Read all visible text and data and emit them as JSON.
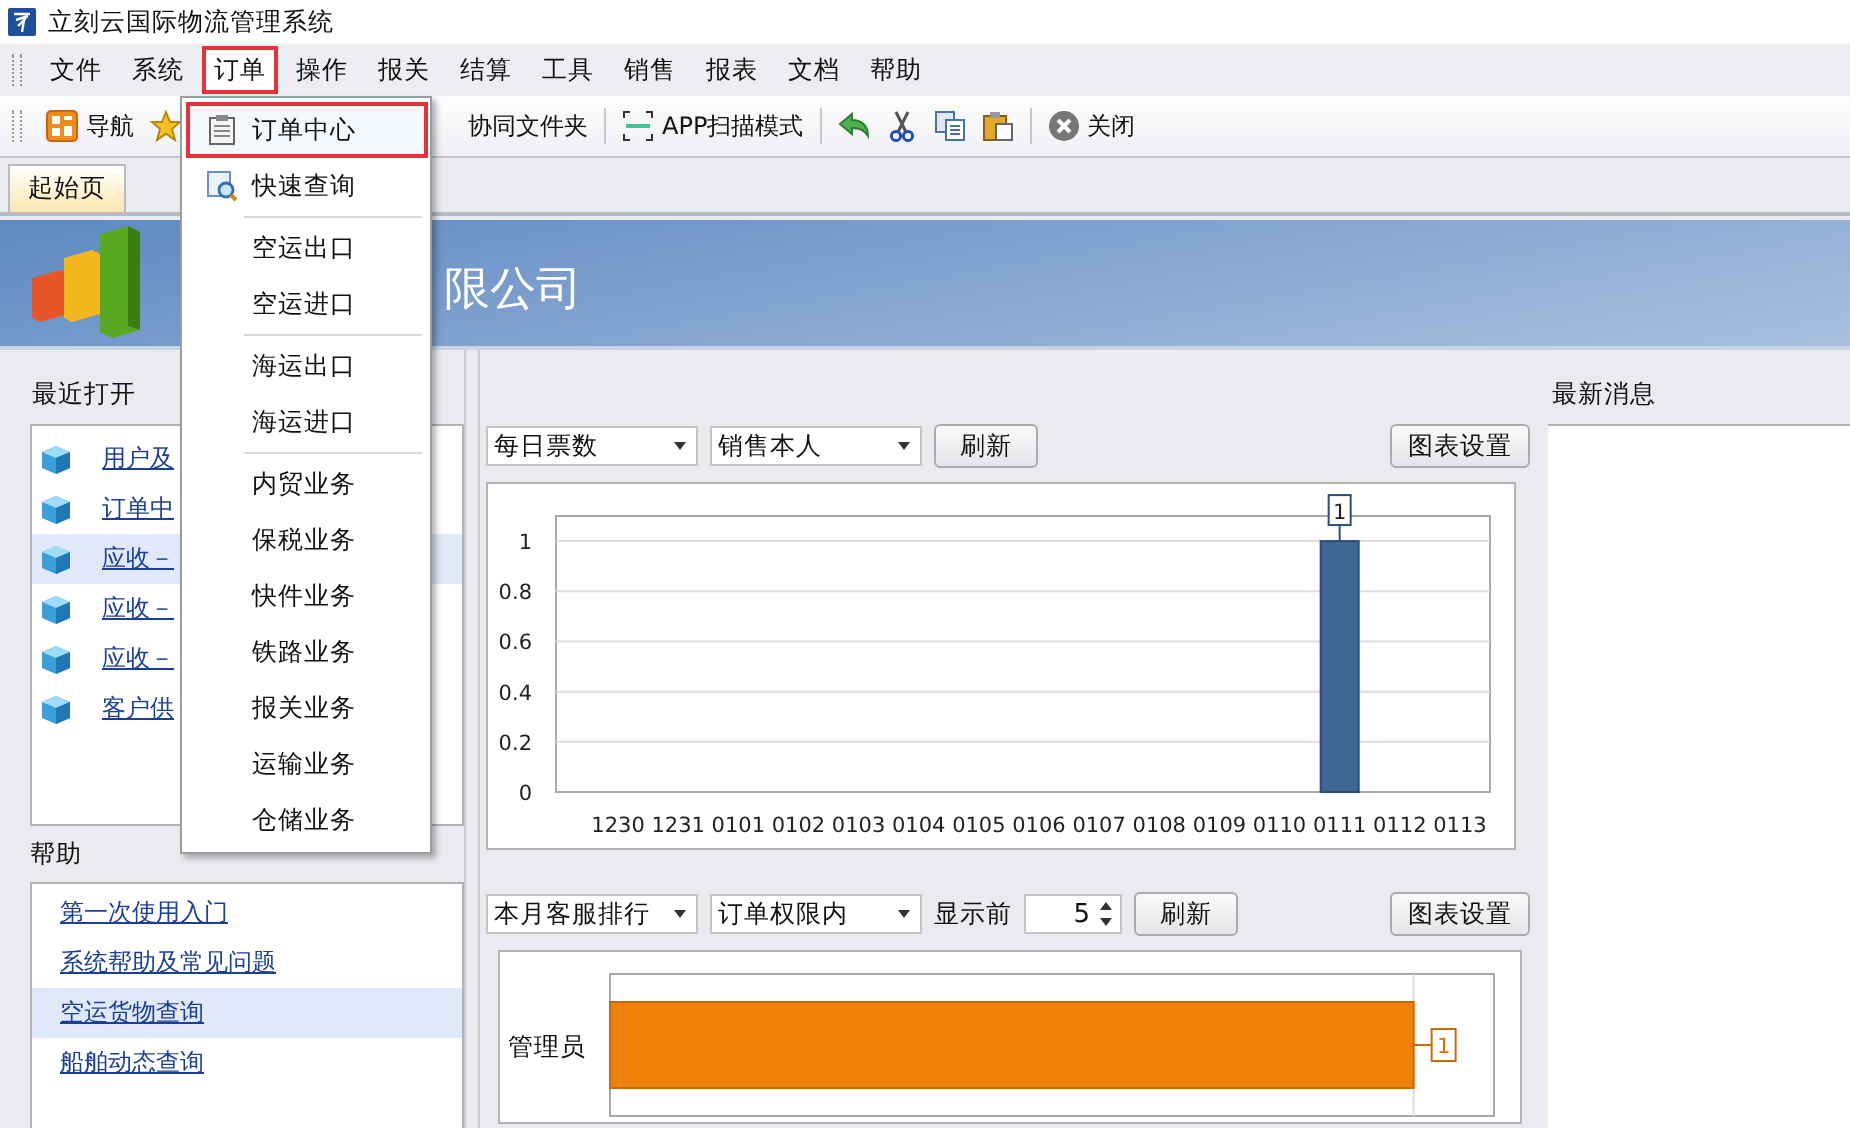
{
  "window": {
    "title": "立刻云国际物流管理系统"
  },
  "menu_bar": [
    {
      "label": "文件",
      "selected": false
    },
    {
      "label": "系统",
      "selected": false
    },
    {
      "label": "订单",
      "selected": true
    },
    {
      "label": "操作",
      "selected": false
    },
    {
      "label": "报关",
      "selected": false
    },
    {
      "label": "结算",
      "selected": false
    },
    {
      "label": "工具",
      "selected": false
    },
    {
      "label": "销售",
      "selected": false
    },
    {
      "label": "报表",
      "selected": false
    },
    {
      "label": "文档",
      "selected": false
    },
    {
      "label": "帮助",
      "selected": false
    }
  ],
  "toolbar": [
    {
      "kind": "nav",
      "label": "导航"
    },
    {
      "kind": "star"
    },
    {
      "kind": "text",
      "label": "协同文件夹"
    },
    {
      "kind": "separator"
    },
    {
      "kind": "scan",
      "label": "APP扫描模式"
    },
    {
      "kind": "separator"
    },
    {
      "kind": "undo"
    },
    {
      "kind": "cut"
    },
    {
      "kind": "copy"
    },
    {
      "kind": "paste"
    },
    {
      "kind": "separator"
    },
    {
      "kind": "close",
      "label": "关闭"
    }
  ],
  "dropdown_menu": {
    "groups": [
      [
        {
          "label": "订单中心",
          "selected": true,
          "kind": "clipboard"
        },
        {
          "label": "快速查询",
          "selected": false,
          "kind": "search"
        }
      ],
      [
        {
          "label": "空运出口",
          "selected": false
        },
        {
          "label": "空运进口",
          "selected": false
        }
      ],
      [
        {
          "label": "海运出口",
          "selected": false
        },
        {
          "label": "海运进口",
          "selected": false
        }
      ],
      [
        {
          "label": "内贸业务",
          "selected": false
        },
        {
          "label": "保税业务",
          "selected": false
        },
        {
          "label": "快件业务",
          "selected": false
        },
        {
          "label": "铁路业务",
          "selected": false
        },
        {
          "label": "报关业务",
          "selected": false
        },
        {
          "label": "运输业务",
          "selected": false
        },
        {
          "label": "仓储业务",
          "selected": false
        }
      ]
    ]
  },
  "tabs": [
    {
      "label": "起始页",
      "selected": true
    }
  ],
  "banner": {
    "company": "限公司"
  },
  "recent": {
    "title": "最近打开",
    "items": [
      {
        "label": "用户及",
        "selected": false
      },
      {
        "label": "订单中",
        "selected": false
      },
      {
        "label": "应收－",
        "selected": true
      },
      {
        "label": "应收－",
        "selected": false
      },
      {
        "label": "应收－",
        "selected": false
      },
      {
        "label": "客户供",
        "selected": false
      }
    ]
  },
  "help": {
    "title": "帮助",
    "items": [
      {
        "label": "第一次使用入门",
        "selected": false
      },
      {
        "label": "系统帮助及常见问题",
        "selected": false
      },
      {
        "label": "空运货物查询",
        "selected": true
      },
      {
        "label": "船舶动态查询",
        "selected": false
      }
    ]
  },
  "daily_chart": {
    "dropdowns": [
      "每日票数",
      "销售本人"
    ],
    "refresh": "刷新",
    "settings": "图表设置",
    "chart_data": {
      "type": "bar",
      "categories": [
        "1230",
        "1231",
        "0101",
        "0102",
        "0103",
        "0104",
        "0105",
        "0106",
        "0107",
        "0108",
        "0109",
        "0110",
        "0111",
        "0112",
        "0113"
      ],
      "values": [
        0,
        0,
        0,
        0,
        0,
        0,
        0,
        0,
        0,
        0,
        0,
        0,
        1,
        0,
        0
      ],
      "ylim": [
        0,
        1.1
      ],
      "yticks": [
        0,
        0.2,
        0.4,
        0.6,
        0.8,
        1
      ],
      "grid": true,
      "value_labels": [
        null,
        null,
        null,
        null,
        null,
        null,
        null,
        null,
        null,
        null,
        null,
        null,
        "1",
        null,
        null
      ]
    }
  },
  "ranking_chart": {
    "dropdowns": [
      "本月客服排行",
      "订单权限内"
    ],
    "top_label": "显示前",
    "top_value": "5",
    "refresh": "刷新",
    "settings": "图表设置",
    "chart_data": {
      "type": "bar",
      "orientation": "horizontal",
      "categories": [
        "管理员"
      ],
      "values": [
        1
      ],
      "data_labels": true
    }
  },
  "news": {
    "title": "最新消息"
  }
}
